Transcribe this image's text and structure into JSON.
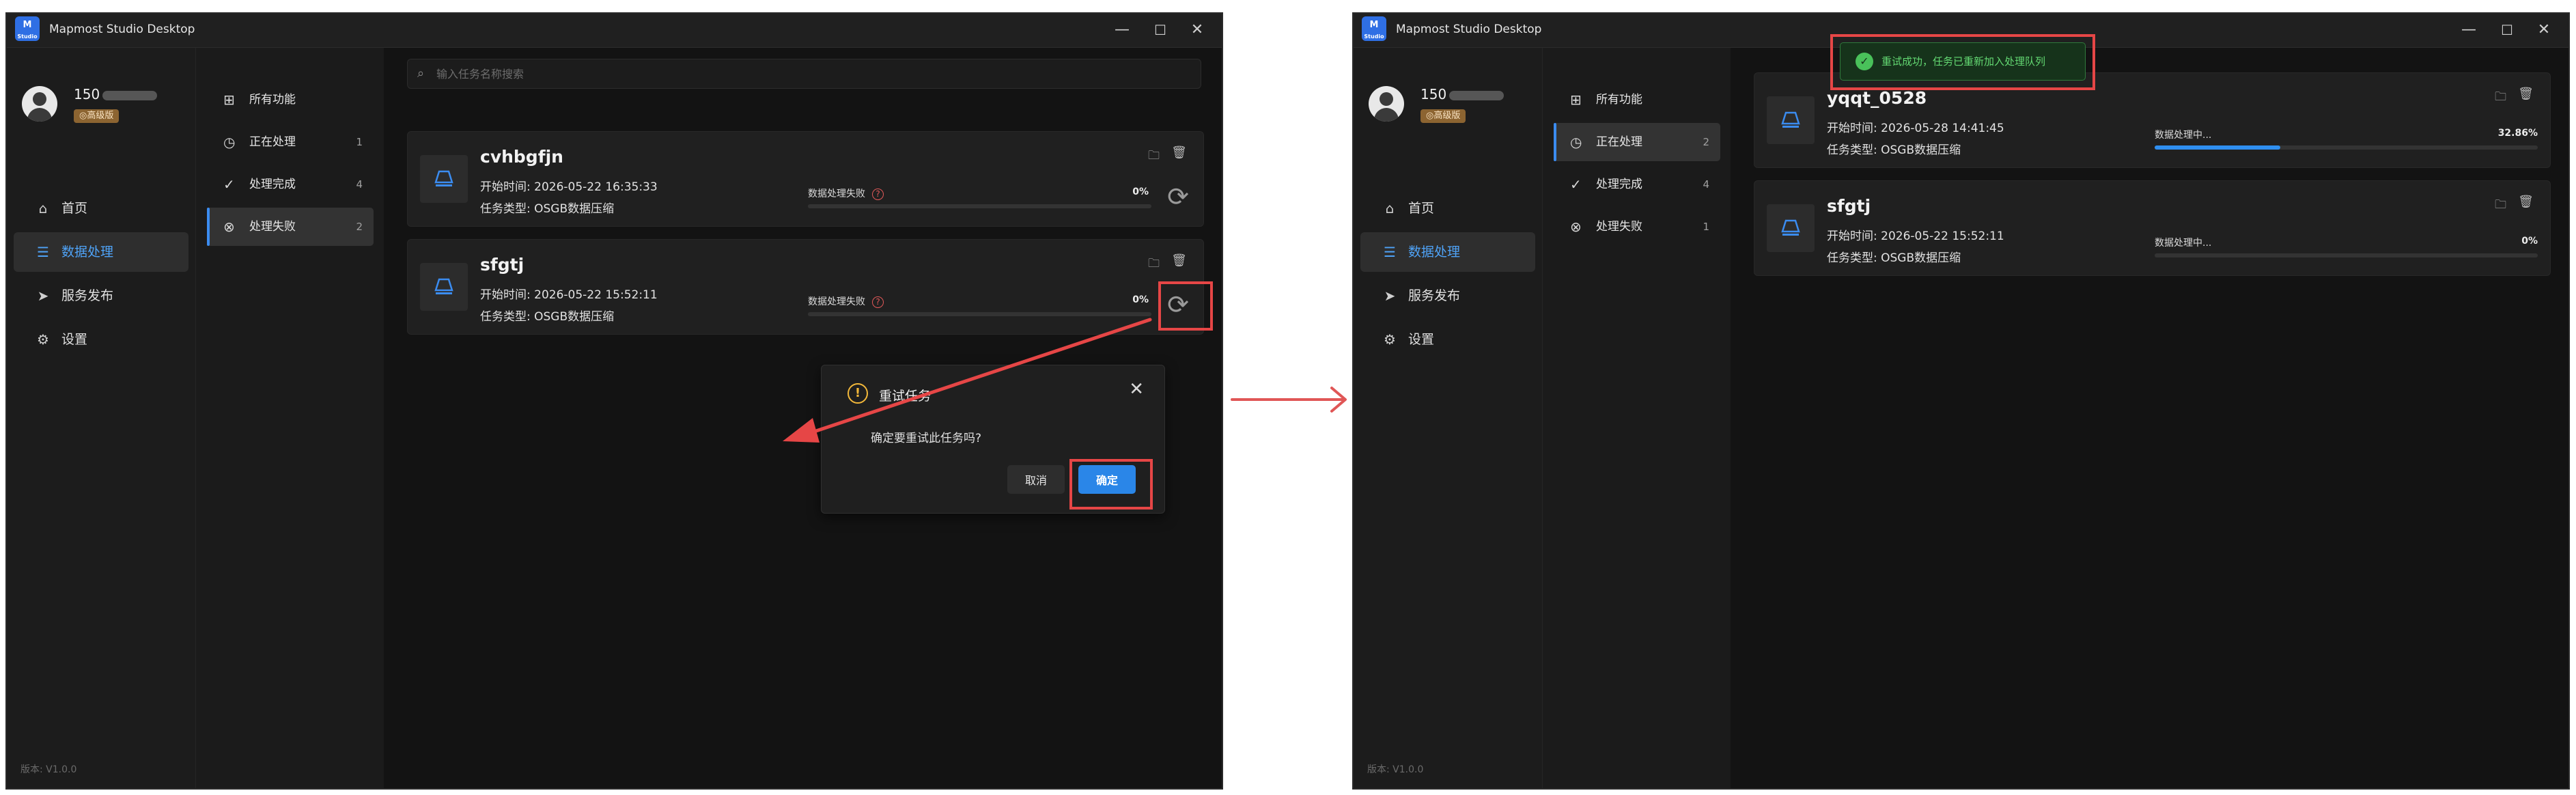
{
  "app": {
    "title": "Mapmost Studio Desktop",
    "logo_text": "M",
    "logo_sub": "Studio"
  },
  "window_controls": {
    "minimize": "—",
    "maximize": "☐",
    "close": "✕"
  },
  "colors": {
    "accent": "#2a86e8",
    "danger": "#e64646",
    "warning": "#f3b83a",
    "success": "#49c15a",
    "badge": "#8c6431"
  },
  "user": {
    "name_prefix": "150",
    "badge": "◎高级版"
  },
  "nav": [
    {
      "label": "首页",
      "icon": "home-icon"
    },
    {
      "label": "数据处理",
      "icon": "database-icon"
    },
    {
      "label": "服务发布",
      "icon": "send-icon"
    },
    {
      "label": "设置",
      "icon": "gear-icon"
    }
  ],
  "version": "版本: V1.0.0",
  "search": {
    "placeholder": "输入任务名称搜索"
  },
  "left": {
    "filters": [
      {
        "label": "所有功能",
        "count": ""
      },
      {
        "label": "正在处理",
        "count": "1"
      },
      {
        "label": "处理完成",
        "count": "4"
      },
      {
        "label": "处理失败",
        "count": "2"
      }
    ],
    "tasks": [
      {
        "name": "cvhbgfjn",
        "time": "开始时间: 2026-05-22 16:35:33",
        "type": "任务类型: OSGB数据压缩",
        "status": "数据处理失败",
        "percent": "0%",
        "progress": 0
      },
      {
        "name": "sfgtj",
        "time": "开始时间: 2026-05-22 15:52:11",
        "type": "任务类型: OSGB数据压缩",
        "status": "数据处理失败",
        "percent": "0%",
        "progress": 0
      }
    ],
    "dialog": {
      "title": "重试任务",
      "message": "确定要重试此任务吗?",
      "cancel": "取消",
      "ok": "确定"
    }
  },
  "right": {
    "filters": [
      {
        "label": "所有功能",
        "count": ""
      },
      {
        "label": "正在处理",
        "count": "2"
      },
      {
        "label": "处理完成",
        "count": "4"
      },
      {
        "label": "处理失败",
        "count": "1"
      }
    ],
    "tasks": [
      {
        "name": "yqqt_0528",
        "time": "开始时间: 2026-05-28 14:41:45",
        "type": "任务类型: OSGB数据压缩",
        "status": "数据处理中...",
        "percent": "32.86%",
        "progress": 0.3286
      },
      {
        "name": "sfgtj",
        "time": "开始时间: 2026-05-22 15:52:11",
        "type": "任务类型: OSGB数据压缩",
        "status": "数据处理中...",
        "percent": "0%",
        "progress": 0
      }
    ],
    "toast": "重试成功，任务已重新加入处理队列"
  }
}
